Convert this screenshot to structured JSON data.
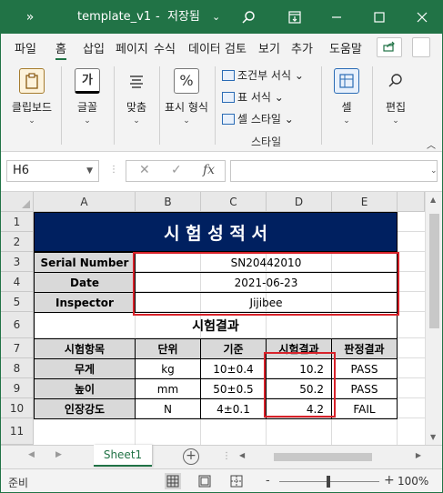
{
  "title": {
    "icon": "»",
    "filename": "template_v1",
    "separator": "-",
    "status": "저장됨",
    "status_arrow": "⌄"
  },
  "tabs": [
    "파일",
    "홈",
    "삽입",
    "페이지",
    "수식",
    "데이터",
    "검토",
    "보기",
    "추가",
    "도움말"
  ],
  "ribbon": {
    "clipboard": "클립보드",
    "font": "글꼴",
    "align": "맞춤",
    "number": "표시 형식",
    "cond_format": "조건부 서식",
    "table_format": "표 서식",
    "cell_style": "셀 스타일",
    "style_group": "스타일",
    "cells": "셀",
    "editing": "편집",
    "font_icon": "가",
    "percent_icon": "%"
  },
  "formula_bar": {
    "name_box": "H6",
    "fx": "fx",
    "cancel": "✕",
    "enter": "✓",
    "value": ""
  },
  "columns": [
    "A",
    "B",
    "C",
    "D",
    "E"
  ],
  "rows": [
    "1",
    "2",
    "3",
    "4",
    "5",
    "6",
    "7",
    "8",
    "9",
    "10",
    "11"
  ],
  "sheet": {
    "title": "시 험 성 적 서",
    "serial_label": "Serial Number",
    "serial_value": "SN20442010",
    "date_label": "Date",
    "date_value": "2021-06-23",
    "inspector_label": "Inspector",
    "inspector_value": "Jijibee",
    "result_title": "시험결과",
    "headers": [
      "시험항목",
      "단위",
      "기준",
      "시험결과",
      "판정결과"
    ],
    "rows": [
      [
        "무게",
        "kg",
        "10±0.4",
        "10.2",
        "PASS"
      ],
      [
        "높이",
        "mm",
        "50±0.5",
        "50.2",
        "PASS"
      ],
      [
        "인장강도",
        "N",
        "4±0.1",
        "4.2",
        "FAIL"
      ]
    ]
  },
  "sheet_tabs": [
    "Sheet1"
  ],
  "status_bar": {
    "ready": "준비",
    "zoom": "100%",
    "zoom_minus": "-",
    "zoom_plus": "+"
  },
  "colors": {
    "excel_green": "#217346",
    "title_fill": "#002060",
    "header_fill": "#d9d9d9",
    "highlight_border": "#d8222a"
  }
}
